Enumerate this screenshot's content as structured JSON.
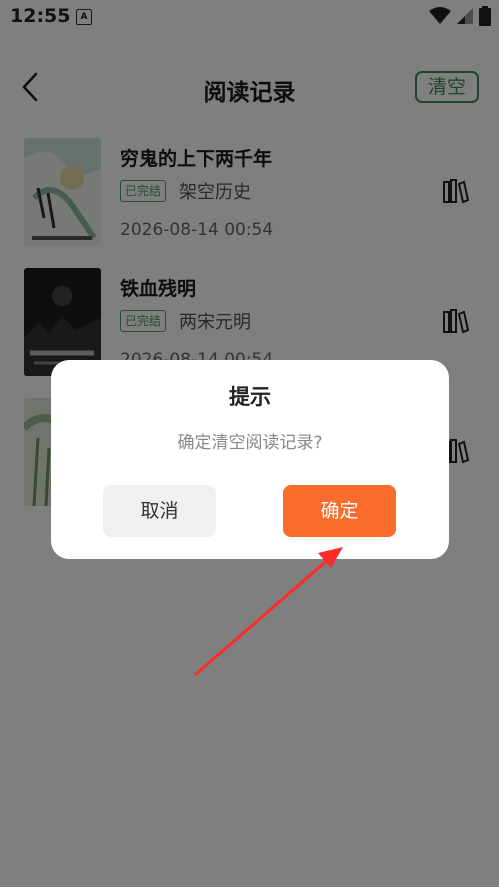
{
  "status_bar": {
    "time": "12:55",
    "notification_icon": "A"
  },
  "header": {
    "title": "阅读记录",
    "clear_label": "清空",
    "back_icon": "chevron-left"
  },
  "books": [
    {
      "title": "穷鬼的上下两千年",
      "status": "已完结",
      "category": "架空历史",
      "date": "2026-08-14 00:54"
    },
    {
      "title": "铁血残明",
      "status": "已完结",
      "category": "两宋元明",
      "date": "2026-08-14 00:54"
    },
    {
      "title": "",
      "status": "",
      "category": "",
      "date": ""
    }
  ],
  "dialog": {
    "title": "提示",
    "message": "确定清空阅读记录?",
    "cancel_label": "取消",
    "confirm_label": "确定"
  },
  "colors": {
    "accent_green": "#3f8a58",
    "confirm_orange": "#fb6b2b",
    "arrow_red": "#ff2a2a"
  }
}
